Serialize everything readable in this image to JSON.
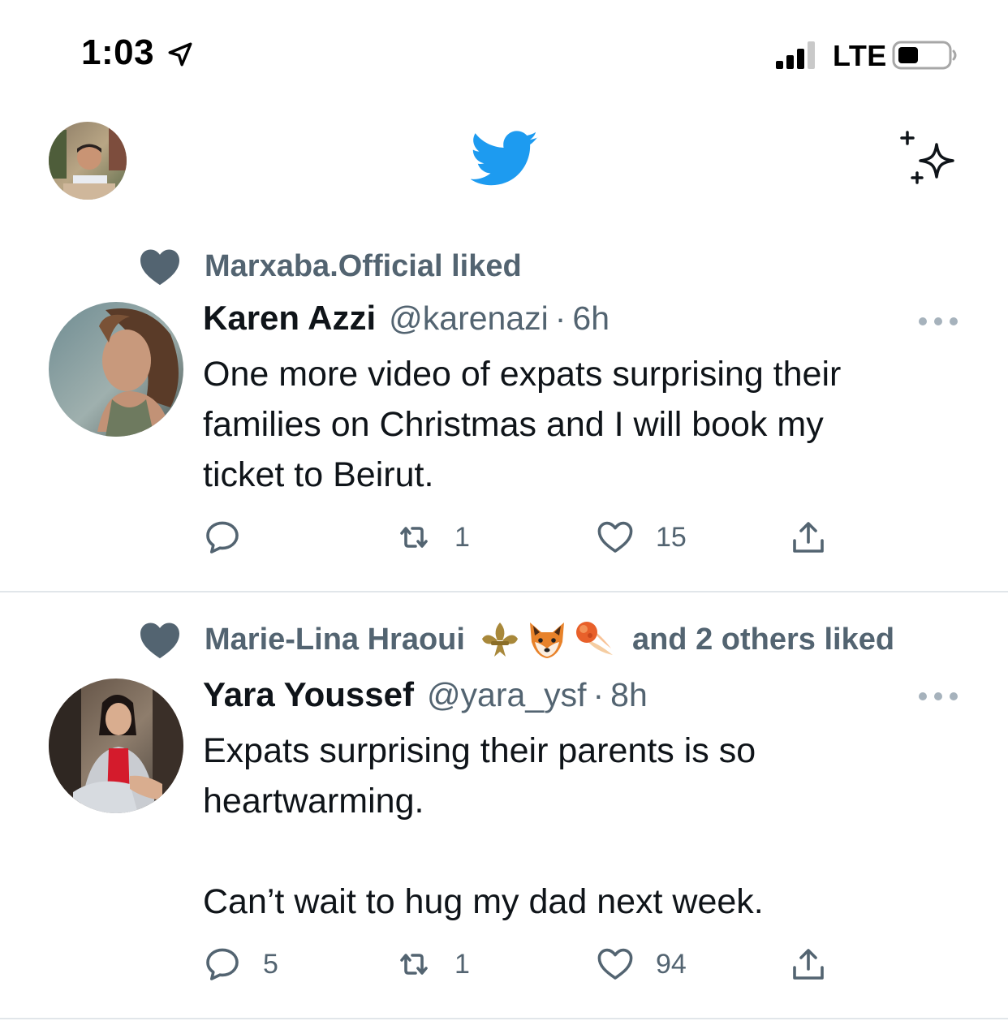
{
  "status_bar": {
    "time": "1:03",
    "network": "LTE",
    "location_icon": "location-arrow-icon",
    "signal_icon": "cellular-signal-icon",
    "battery_icon": "battery-icon"
  },
  "header": {
    "profile_avatar_icon": "user-avatar",
    "logo_icon": "twitter-bird-icon",
    "sparkle_icon": "sparkle-icon"
  },
  "colors": {
    "twitter_blue": "#1d9bf0",
    "secondary_text": "#536471",
    "primary_text": "#0f1419",
    "divider": "#e1e6ea"
  },
  "tweets": [
    {
      "social_context": "Marxaba.Official liked",
      "name": "Karen Azzi",
      "handle": "@karenazi",
      "separator": "·",
      "time": "6h",
      "body": [
        "One more video of expats surprising their",
        "families on Christmas and I will book my",
        "ticket to Beirut."
      ],
      "reply_count": "",
      "retweet_count": "1",
      "like_count": "15"
    },
    {
      "social_context_name": "Marie-Lina Hraoui",
      "social_context_emojis": [
        "fleur-de-lis-icon",
        "fox-icon",
        "comet-icon"
      ],
      "social_context_suffix": "and 2 others liked",
      "name": "Yara Youssef",
      "handle": "@yara_ysf",
      "separator": "·",
      "time": "8h",
      "body": [
        "Expats surprising their parents is so",
        "heartwarming."
      ],
      "body_2": "Can’t wait to hug my dad next week.",
      "reply_count": "5",
      "retweet_count": "1",
      "like_count": "94"
    }
  ]
}
